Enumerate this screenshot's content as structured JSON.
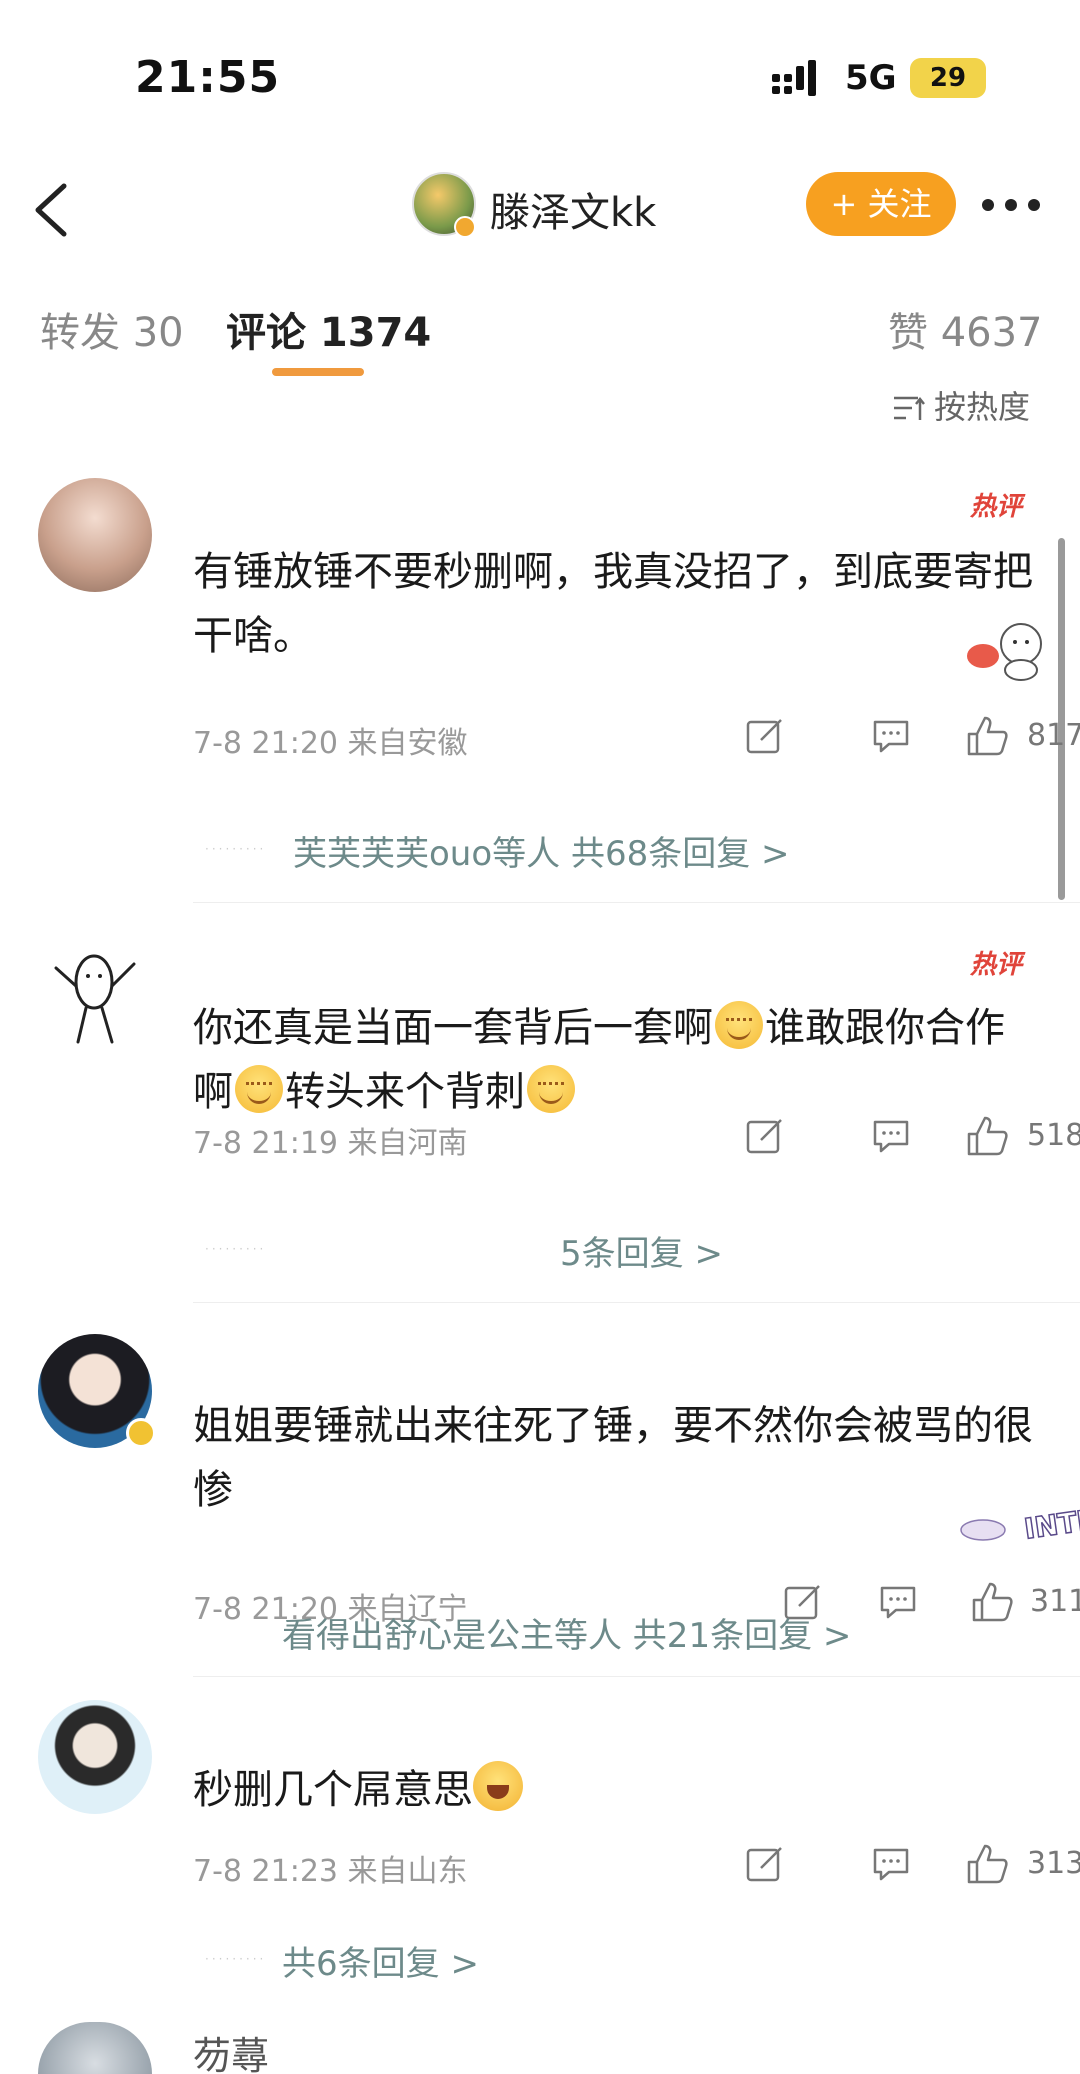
{
  "status_bar": {
    "time": "21:55",
    "network": "5G",
    "battery": "29"
  },
  "header": {
    "username": "滕泽文kk",
    "follow_label": "+ 关注"
  },
  "tabs": {
    "repost": "转发 30",
    "comments": "评论 1374",
    "likes": "赞 4637"
  },
  "sort_label": "按热度",
  "comments": [
    {
      "badge": "热评",
      "text": "有锤放锤不要秒删啊，我真没招了，到底要寄把干啥。",
      "meta": "7-8 21:20  来自安徽",
      "likes": "817",
      "replies": "芙芙芙芙ouo等人  共68条回复 >"
    },
    {
      "badge": "热评",
      "text_parts": [
        "你还真是当面一套背后一套啊",
        "谁敢跟你合作啊",
        "转头来个背刺"
      ],
      "meta": "7-8 21:19  来自河南",
      "likes": "518",
      "replies": "5条回复 >"
    },
    {
      "text": "姐姐要锤就出来往死了锤，要不然你会被骂的很惨",
      "meta": "7-8 21:20  来自辽宁",
      "likes": "311",
      "replies": "看得出舒心是公主等人  共21条回复 >",
      "sticker": "INTP"
    },
    {
      "text": "秒删几个屌意思",
      "meta": "7-8 21:23  来自山东",
      "likes": "313",
      "replies": "共6条回复 >"
    }
  ],
  "next_comment_name": "芴蕁",
  "colors": {
    "accent": "#f7a020",
    "tab_underline": "#f09a3e",
    "reply_link": "#6d8a8a",
    "hot_badge": "#e0443a"
  },
  "icons": [
    "back-arrow-icon",
    "more-icon",
    "sort-icon",
    "share-icon",
    "comment-icon",
    "like-icon",
    "verified-icon"
  ]
}
